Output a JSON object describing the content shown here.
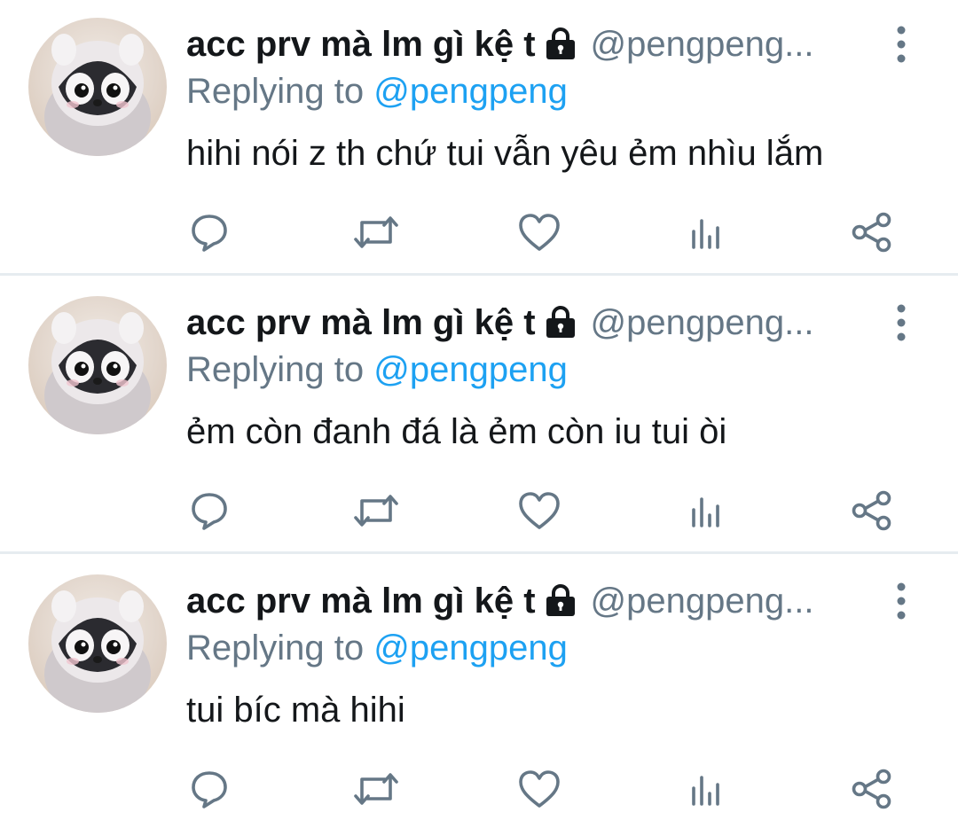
{
  "colors": {
    "text_primary": "#14171a",
    "text_secondary": "#657786",
    "link_blue": "#1da1f2",
    "divider": "#e6ecf0"
  },
  "tweets": [
    {
      "display_name": "acc prv mà lm gì kệ t",
      "handle": "@pengpeng...",
      "reply_prefix": "Replying to",
      "reply_to": "@pengpeng",
      "text": "hihi nói z th chứ tui vẫn yêu ẻm nhìu lắm",
      "icons": [
        "lock-icon",
        "more-icon",
        "reply-icon",
        "retweet-icon",
        "like-icon",
        "stats-icon",
        "share-icon"
      ]
    },
    {
      "display_name": "acc prv mà lm gì kệ t",
      "handle": "@pengpeng...",
      "reply_prefix": "Replying to",
      "reply_to": "@pengpeng",
      "text": "ẻm còn đanh đá là ẻm còn iu tui òi",
      "icons": [
        "lock-icon",
        "more-icon",
        "reply-icon",
        "retweet-icon",
        "like-icon",
        "stats-icon",
        "share-icon"
      ]
    },
    {
      "display_name": "acc prv mà lm gì kệ t",
      "handle": "@pengpeng...",
      "reply_prefix": "Replying to",
      "reply_to": "@pengpeng",
      "text": "tui bíc mà hihi",
      "icons": [
        "lock-icon",
        "more-icon",
        "reply-icon",
        "retweet-icon",
        "like-icon",
        "stats-icon",
        "share-icon"
      ]
    }
  ]
}
